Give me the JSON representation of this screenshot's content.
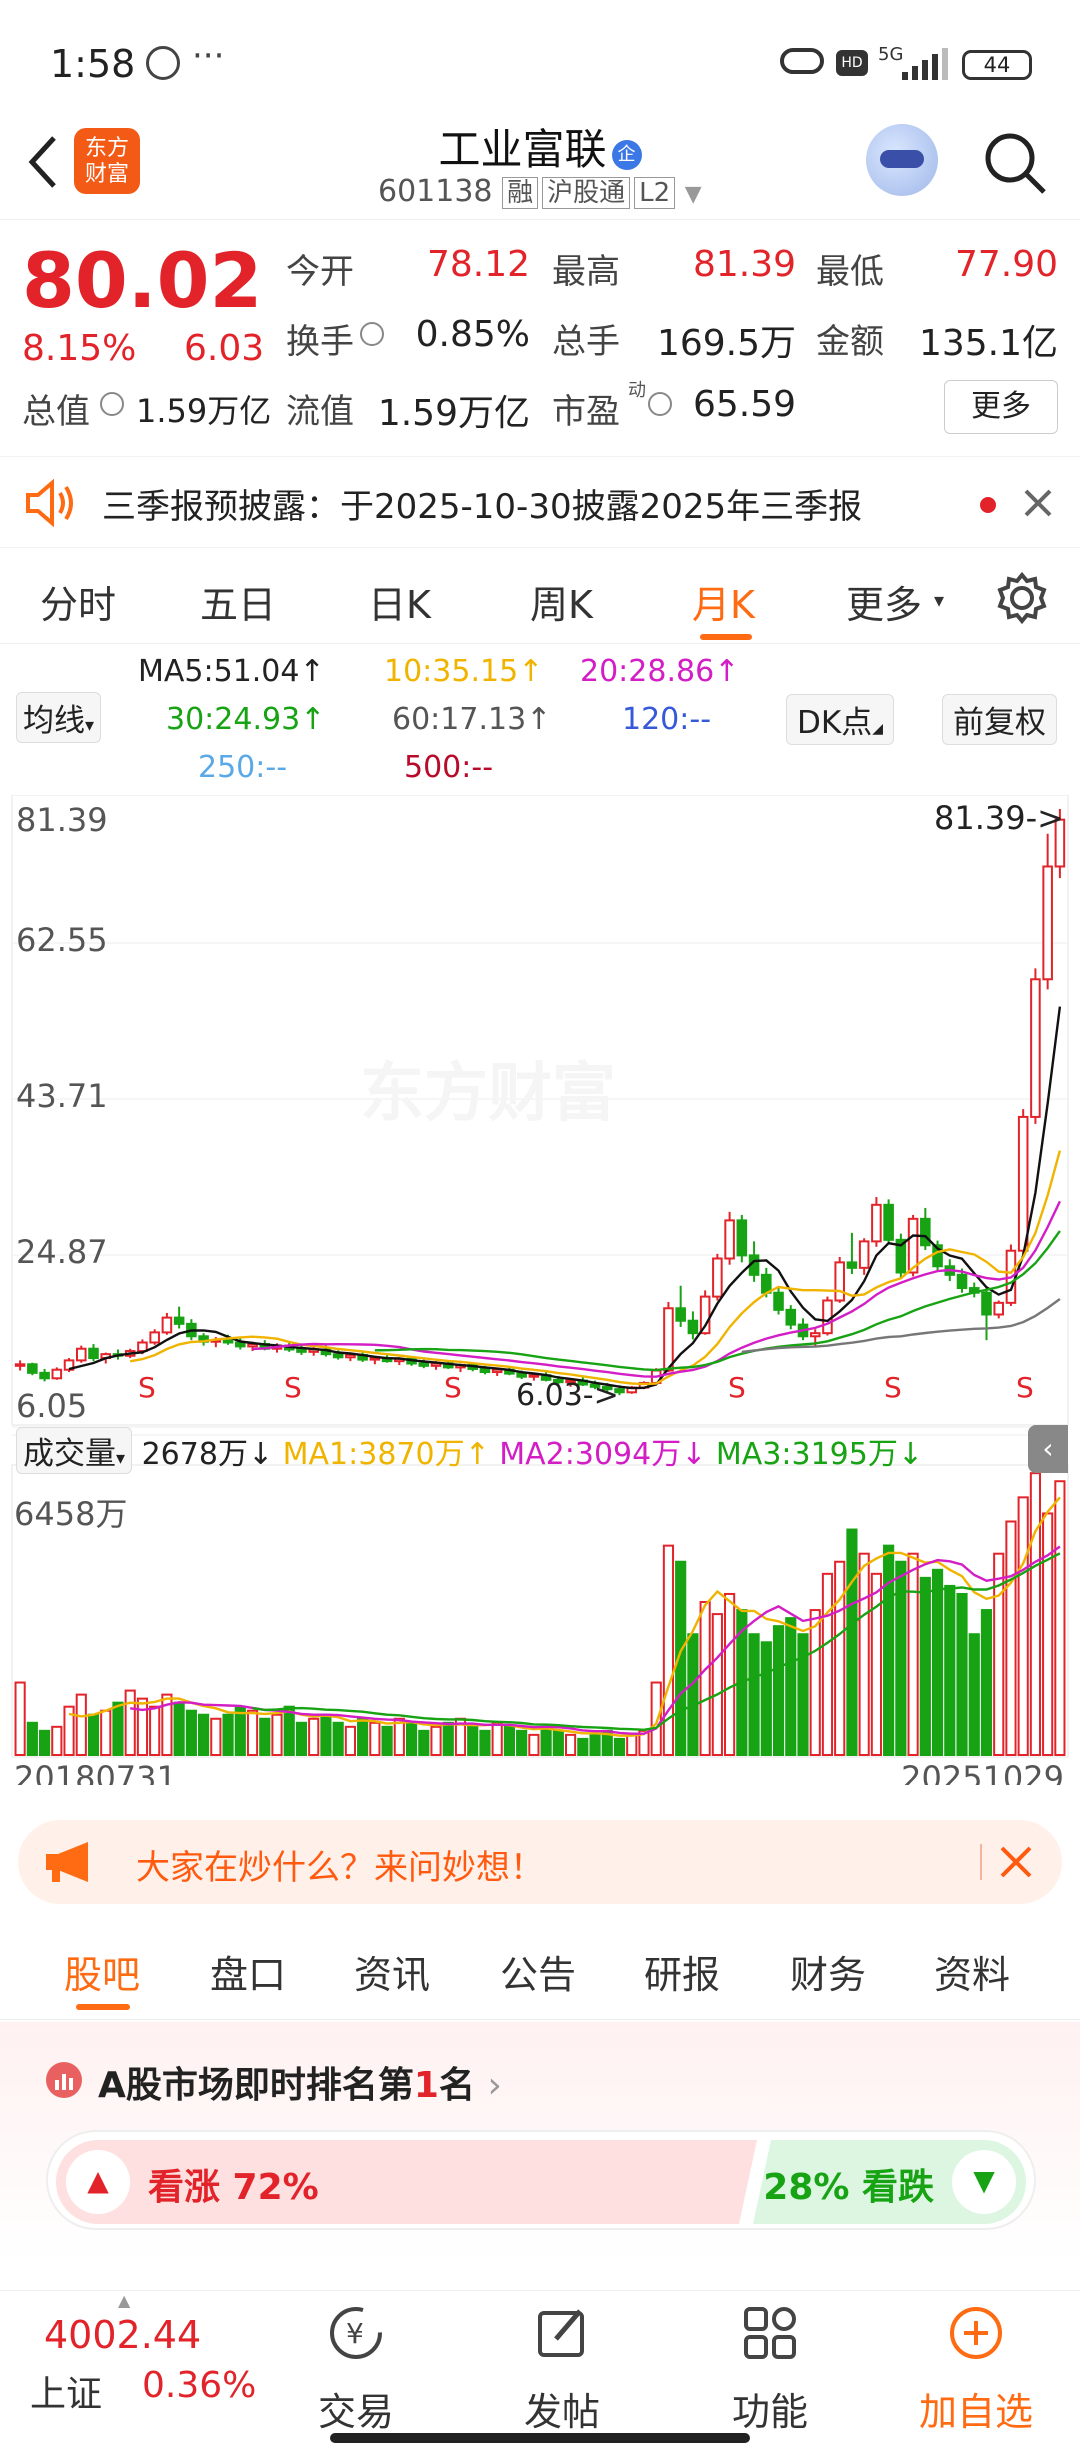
{
  "status": {
    "time": "1:58",
    "dots": "···",
    "net": "5G",
    "battery": "44"
  },
  "header": {
    "title": "工业富联",
    "code": "601138",
    "tags": [
      "融",
      "沪股通",
      "L2"
    ],
    "logo_text": "东方\n财富"
  },
  "quote": {
    "price": "80.02",
    "change_pct": "8.15%",
    "change": "6.03",
    "open_label": "今开",
    "open": "78.12",
    "high_label": "最高",
    "high": "81.39",
    "low_label": "最低",
    "low": "77.90",
    "turnover_label": "换手",
    "turnover": "0.85%",
    "volume_label": "总手",
    "volume": "169.5万",
    "amount_label": "金额",
    "amount": "135.1亿",
    "mktcap_label": "总值",
    "mktcap": "1.59万亿",
    "float_label": "流值",
    "float": "1.59万亿",
    "pe_label": "市盈",
    "pe_sup": "动",
    "pe": "65.59",
    "more": "更多"
  },
  "notice": {
    "text": "三季报预披露：于2025-10-30披露2025年三季报"
  },
  "tabs": [
    "分时",
    "五日",
    "日K",
    "周K",
    "月K",
    "更多"
  ],
  "active_tab": "月K",
  "ma": {
    "selector": "均线",
    "ma5": "MA5:51.04↑",
    "ma10": "10:35.15↑",
    "ma20": "20:28.86↑",
    "ma30": "30:24.93↑",
    "ma60": "60:17.13↑",
    "ma120": "120:--",
    "ma250": "250:--",
    "ma500": "500:--",
    "dk": "DK点",
    "fq": "前复权"
  },
  "chart": {
    "y_ticks": [
      "81.39",
      "62.55",
      "43.71",
      "24.87",
      "6.05"
    ],
    "max_label": "81.39->",
    "min_label": "6.03->",
    "vol_selector": "成交量",
    "vol_value": "2678万↓",
    "vol_ma1": "MA1:3870万↑",
    "vol_ma2": "MA2:3094万↓",
    "vol_ma3": "MA3:3195万↓",
    "vol_max": "6458万",
    "date_start": "20180731",
    "date_end": "20251029",
    "watermark": "东方财富",
    "s_mark": "S"
  },
  "chart_data": {
    "type": "candlestick",
    "ylim": [
      6.05,
      81.39
    ],
    "start": "20180731",
    "end": "20251029",
    "candles": [
      [
        9.8,
        10.5,
        9.2,
        10.0
      ],
      [
        10.0,
        10.2,
        8.6,
        8.9
      ],
      [
        8.9,
        9.4,
        7.8,
        8.2
      ],
      [
        8.2,
        9.6,
        8.0,
        9.3
      ],
      [
        9.3,
        10.8,
        9.0,
        10.5
      ],
      [
        10.5,
        12.4,
        10.2,
        12.0
      ],
      [
        12.0,
        12.6,
        10.4,
        10.8
      ],
      [
        10.8,
        11.5,
        10.1,
        11.3
      ],
      [
        11.3,
        11.9,
        10.6,
        11.1
      ],
      [
        11.1,
        12.0,
        10.8,
        11.7
      ],
      [
        11.7,
        13.2,
        11.3,
        12.8
      ],
      [
        12.8,
        14.5,
        12.5,
        14.1
      ],
      [
        14.1,
        16.6,
        13.8,
        16.0
      ],
      [
        16.0,
        17.4,
        14.6,
        15.2
      ],
      [
        15.2,
        15.8,
        13.1,
        13.6
      ],
      [
        13.6,
        14.0,
        12.4,
        12.9
      ],
      [
        12.9,
        13.5,
        12.2,
        13.1
      ],
      [
        13.1,
        13.8,
        12.5,
        12.8
      ],
      [
        12.8,
        13.4,
        11.9,
        12.3
      ],
      [
        12.3,
        12.9,
        11.7,
        12.6
      ],
      [
        12.6,
        13.1,
        11.8,
        12.0
      ],
      [
        12.0,
        12.7,
        11.5,
        12.4
      ],
      [
        12.4,
        12.9,
        11.6,
        11.9
      ],
      [
        11.9,
        12.5,
        11.2,
        11.6
      ],
      [
        11.6,
        12.2,
        11.1,
        11.9
      ],
      [
        11.9,
        12.4,
        11.0,
        11.3
      ],
      [
        11.3,
        11.8,
        10.6,
        10.9
      ],
      [
        10.9,
        11.5,
        10.4,
        11.2
      ],
      [
        11.2,
        11.6,
        10.3,
        10.6
      ],
      [
        10.6,
        11.1,
        10.0,
        10.8
      ],
      [
        10.8,
        11.3,
        10.2,
        10.4
      ],
      [
        10.4,
        10.9,
        9.9,
        10.7
      ],
      [
        10.7,
        11.0,
        9.8,
        10.1
      ],
      [
        10.1,
        10.6,
        9.5,
        9.8
      ],
      [
        9.8,
        10.4,
        9.3,
        10.1
      ],
      [
        10.1,
        10.5,
        9.4,
        9.6
      ],
      [
        9.6,
        10.1,
        9.0,
        9.9
      ],
      [
        9.9,
        10.3,
        9.1,
        9.4
      ],
      [
        9.4,
        9.8,
        8.7,
        9.0
      ],
      [
        9.0,
        9.5,
        8.5,
        9.3
      ],
      [
        9.3,
        9.7,
        8.6,
        8.8
      ],
      [
        8.8,
        9.2,
        8.1,
        8.4
      ],
      [
        8.4,
        8.9,
        7.9,
        8.6
      ],
      [
        8.6,
        9.0,
        7.8,
        8.0
      ],
      [
        8.0,
        8.5,
        7.4,
        7.7
      ],
      [
        7.7,
        8.2,
        7.1,
        7.9
      ],
      [
        7.9,
        8.3,
        7.2,
        7.4
      ],
      [
        7.4,
        7.9,
        6.8,
        7.1
      ],
      [
        7.1,
        7.6,
        6.5,
        6.8
      ],
      [
        6.8,
        7.3,
        6.03,
        6.4
      ],
      [
        6.4,
        7.2,
        6.2,
        7.0
      ],
      [
        7.0,
        7.8,
        6.8,
        7.6
      ],
      [
        7.6,
        9.5,
        7.4,
        9.2
      ],
      [
        9.2,
        18.0,
        9.0,
        17.2
      ],
      [
        17.2,
        20.1,
        14.8,
        15.6
      ],
      [
        15.6,
        16.8,
        13.2,
        14.0
      ],
      [
        14.0,
        19.5,
        13.8,
        18.7
      ],
      [
        18.7,
        24.2,
        18.2,
        23.6
      ],
      [
        23.6,
        29.6,
        22.8,
        28.5
      ],
      [
        28.5,
        29.2,
        23.1,
        24.0
      ],
      [
        24.0,
        25.8,
        20.6,
        21.5
      ],
      [
        21.5,
        22.4,
        18.6,
        19.2
      ],
      [
        19.2,
        19.8,
        16.4,
        17.0
      ],
      [
        17.0,
        17.6,
        14.5,
        15.1
      ],
      [
        15.1,
        15.9,
        13.1,
        13.6
      ],
      [
        13.6,
        14.5,
        12.3,
        14.0
      ],
      [
        14.0,
        18.7,
        13.7,
        18.2
      ],
      [
        18.2,
        23.8,
        17.9,
        23.1
      ],
      [
        23.1,
        26.9,
        21.6,
        22.4
      ],
      [
        22.4,
        26.2,
        21.5,
        25.8
      ],
      [
        25.8,
        31.5,
        25.1,
        30.5
      ],
      [
        30.5,
        31.2,
        25.4,
        26.0
      ],
      [
        26.0,
        26.8,
        21.0,
        21.8
      ],
      [
        21.8,
        29.2,
        21.3,
        28.7
      ],
      [
        28.7,
        30.1,
        24.7,
        25.3
      ],
      [
        25.3,
        25.9,
        21.9,
        22.6
      ],
      [
        22.6,
        23.5,
        20.7,
        21.5
      ],
      [
        21.5,
        22.3,
        19.2,
        19.8
      ],
      [
        19.8,
        20.5,
        18.6,
        19.2
      ],
      [
        19.2,
        20.0,
        13.1,
        16.4
      ],
      [
        16.4,
        18.2,
        15.9,
        17.9
      ],
      [
        17.9,
        25.4,
        17.5,
        24.6
      ],
      [
        24.6,
        42.8,
        24.0,
        41.8
      ],
      [
        41.8,
        60.9,
        40.9,
        59.5
      ],
      [
        59.5,
        78.2,
        58.2,
        74.0
      ],
      [
        74.0,
        81.39,
        72.5,
        80.02
      ]
    ],
    "ma": [
      {
        "name": "MA5",
        "color": "#111111",
        "value": 51.04
      },
      {
        "name": "MA10",
        "color": "#f0b400",
        "value": 35.15
      },
      {
        "name": "MA20",
        "color": "#d31ec6",
        "value": 28.86
      },
      {
        "name": "MA30",
        "color": "#17a313",
        "value": 24.93
      },
      {
        "name": "MA60",
        "color": "#777777",
        "value": 17.13
      }
    ],
    "volume": [
      18,
      8,
      6,
      7,
      12,
      15,
      10,
      11,
      13,
      16,
      14,
      12,
      15,
      13,
      11,
      10,
      9,
      10,
      12,
      11,
      9,
      10,
      12,
      8,
      9,
      10,
      8,
      7,
      9,
      8,
      7,
      9,
      8,
      6,
      7,
      8,
      9,
      7,
      6,
      8,
      7,
      6,
      5,
      7,
      6,
      5,
      4,
      5,
      6,
      4,
      5,
      6,
      18,
      52,
      48,
      30,
      38,
      35,
      40,
      36,
      30,
      28,
      32,
      34,
      30,
      36,
      45,
      48,
      56,
      50,
      45,
      52,
      48,
      50,
      44,
      46,
      42,
      40,
      30,
      36,
      50,
      58,
      64,
      70,
      60,
      68
    ],
    "volume_max": 64.58
  },
  "ask": {
    "text": "大家在炒什么？来问妙想！"
  },
  "feature_tabs": [
    "股吧",
    "盘口",
    "资讯",
    "公告",
    "研报",
    "财务",
    "资料"
  ],
  "active_feature_tab": "股吧",
  "rank": {
    "text": "A股市场即时排名第1名",
    "prefix": "A股市场即时排名第",
    "num": "1",
    "suffix": "名",
    "up": "看涨 72%",
    "down": "28% 看跌",
    "up_pct": 72
  },
  "bottom": {
    "index_value": "4002.44",
    "index_name": "上证",
    "index_change": "0.36%",
    "trade": "交易",
    "post": "发帖",
    "func": "功能",
    "add": "加自选"
  },
  "colors": {
    "up": "#e2232a",
    "down": "#17a313",
    "accent": "#ff6b12"
  }
}
